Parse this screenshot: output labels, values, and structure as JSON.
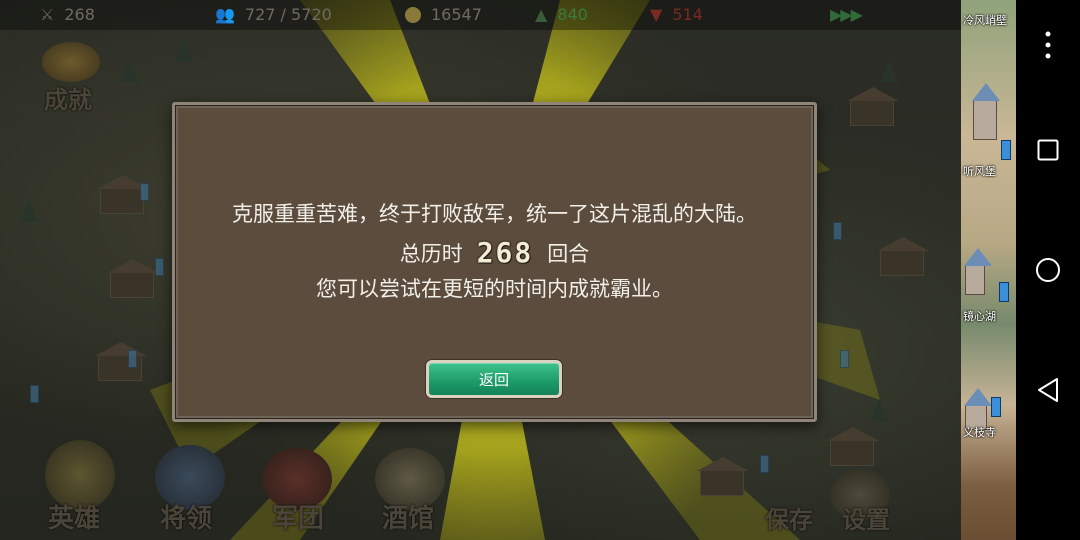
{
  "topbar": {
    "score": "268",
    "population": "727 / 5720",
    "gold": "16547",
    "income": "840",
    "expense": "514"
  },
  "side_menu": {
    "achievement_label": "成就"
  },
  "bottom_menu": {
    "hero_label": "英雄",
    "general_label": "将领",
    "army_label": "军团",
    "tavern_label": "酒馆",
    "save_label": "保存",
    "settings_label": "设置"
  },
  "dialog": {
    "line1": "克服重重苦难，终于打败敌军，统一了这片混乱的大陆。",
    "line2_prefix": "总历时",
    "turns": "268",
    "line2_suffix": "回合",
    "line3": "您可以尝试在更短的时间内成就霸业。",
    "back_label": "返回"
  },
  "minimap": {
    "labels": [
      "冷风峭壁",
      "听风堡",
      "镜心湖",
      "义枝寺"
    ]
  },
  "colors": {
    "dialog_bg": "#5b4c3d",
    "button_green": "#1c9a66",
    "ray_yellow": "#d8d21c",
    "income_green": "#3bb54a",
    "expense_red": "#b8332c"
  },
  "icons": {
    "score": "sword-icon",
    "population": "people-icon",
    "gold": "coin-icon",
    "income": "up-arrow-icon",
    "expense": "down-arrow-icon",
    "speed": "fast-forward-icon"
  }
}
